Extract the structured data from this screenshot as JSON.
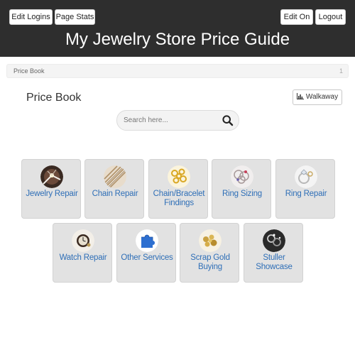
{
  "header": {
    "title": "My Jewelry Store Price Guide",
    "buttons": {
      "edit_logins": "Edit Logins",
      "page_stats": "Page Stats",
      "edit_on": "Edit On",
      "logout": "Logout"
    },
    "background_color": "#2e2e2e"
  },
  "breadcrumb": {
    "current": "Price Book",
    "number": "1"
  },
  "page": {
    "title": "Price Book",
    "walkaway_label": "Walkaway"
  },
  "search": {
    "placeholder": "Search here...",
    "value": ""
  },
  "tiles": [
    {
      "label": "Jewelry Repair",
      "icon": "jewelry-repair-icon"
    },
    {
      "label": "Chain Repair",
      "icon": "chain-icon"
    },
    {
      "label": "Chain/Bracelet Findings",
      "icon": "findings-icon"
    },
    {
      "label": "Ring Sizing",
      "icon": "ring-sizing-icon"
    },
    {
      "label": "Ring Repair",
      "icon": "ring-repair-icon"
    },
    {
      "label": "Watch Repair",
      "icon": "watch-icon"
    },
    {
      "label": "Other Services",
      "icon": "puzzle-piece-icon"
    },
    {
      "label": "Scrap Gold Buying",
      "icon": "gold-nuggets-icon"
    },
    {
      "label": "Stuller Showcase",
      "icon": "showcase-icon"
    }
  ],
  "colors": {
    "tile_background": "#e2e2e2",
    "tile_label": "#2f6fb7"
  }
}
